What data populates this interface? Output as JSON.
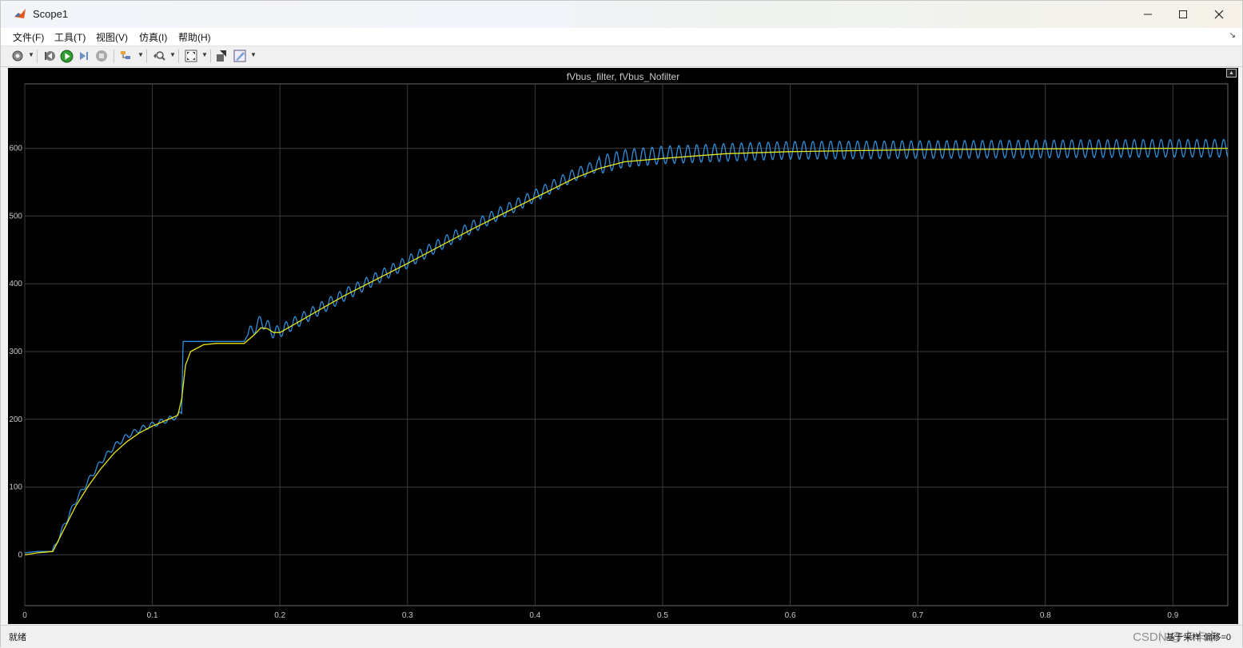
{
  "window": {
    "title": "Scope1",
    "app_icon": "matlab-icon",
    "controls": [
      "minimize-icon",
      "maximize-icon",
      "close-icon"
    ]
  },
  "menu": {
    "items": [
      "文件(F)",
      "工具(T)",
      "视图(V)",
      "仿真(I)",
      "帮助(H)"
    ]
  },
  "toolbar": {
    "buttons": [
      "settings-icon",
      "step-back-icon",
      "run-icon",
      "step-forward-icon",
      "stop-icon",
      "highlight-icon",
      "zoom-icon",
      "fit-to-view-icon",
      "send-icon",
      "properties-icon"
    ]
  },
  "scope": {
    "title": "fVbus_filter, fVbus_Nofilter",
    "background": "#000000",
    "grid_color": "#3c3c3c"
  },
  "status": {
    "left": "就绪",
    "right": "基于采样  偏移=0",
    "watermark": "CSDN @卡卡卡"
  },
  "chart_data": {
    "type": "line",
    "title": "fVbus_filter, fVbus_Nofilter",
    "xlim": [
      0,
      0.943
    ],
    "ylim": [
      -75,
      695
    ],
    "xticks": [
      0,
      0.1,
      0.2,
      0.3,
      0.4,
      0.5,
      0.6,
      0.7,
      0.8,
      0.9
    ],
    "yticks": [
      0,
      100,
      200,
      300,
      400,
      500,
      600
    ],
    "grid": true,
    "series": [
      {
        "color": "#2f8fd9",
        "x": [
          0,
          0.01,
          0.022,
          0.03,
          0.04,
          0.05,
          0.06,
          0.07,
          0.08,
          0.09,
          0.1,
          0.11,
          0.12,
          0.123,
          0.124,
          0.13,
          0.14,
          0.15,
          0.16,
          0.172,
          0.175,
          0.18,
          0.185,
          0.19,
          0.195,
          0.2,
          0.25,
          0.3,
          0.35,
          0.4,
          0.43,
          0.45,
          0.47,
          0.5,
          0.55,
          0.6,
          0.7,
          0.8,
          0.9,
          0.943
        ],
        "values": [
          3,
          5,
          5,
          40,
          80,
          110,
          138,
          160,
          175,
          185,
          192,
          198,
          205,
          210,
          315,
          315,
          315,
          315,
          315,
          315,
          325,
          335,
          345,
          338,
          328,
          330,
          383,
          432,
          483,
          530,
          560,
          575,
          585,
          590,
          594,
          597,
          598,
          599,
          600,
          600
        ],
        "ripple": {
          "start": 0.175,
          "period": 0.007,
          "amplitude": [
            9,
            13
          ]
        }
      },
      {
        "color": "#e6e619",
        "x": [
          0,
          0.01,
          0.022,
          0.03,
          0.04,
          0.05,
          0.06,
          0.07,
          0.08,
          0.09,
          0.1,
          0.11,
          0.12,
          0.123,
          0.126,
          0.13,
          0.14,
          0.15,
          0.16,
          0.172,
          0.18,
          0.185,
          0.19,
          0.195,
          0.2,
          0.25,
          0.3,
          0.35,
          0.4,
          0.43,
          0.45,
          0.47,
          0.5,
          0.55,
          0.6,
          0.7,
          0.8,
          0.9,
          0.943
        ],
        "values": [
          0,
          3,
          5,
          35,
          72,
          102,
          128,
          150,
          167,
          180,
          190,
          198,
          206,
          230,
          280,
          300,
          310,
          312,
          312,
          312,
          325,
          335,
          334,
          328,
          328,
          382,
          430,
          480,
          527,
          555,
          570,
          580,
          585,
          592,
          595,
          598,
          599,
          600,
          600
        ]
      }
    ]
  }
}
